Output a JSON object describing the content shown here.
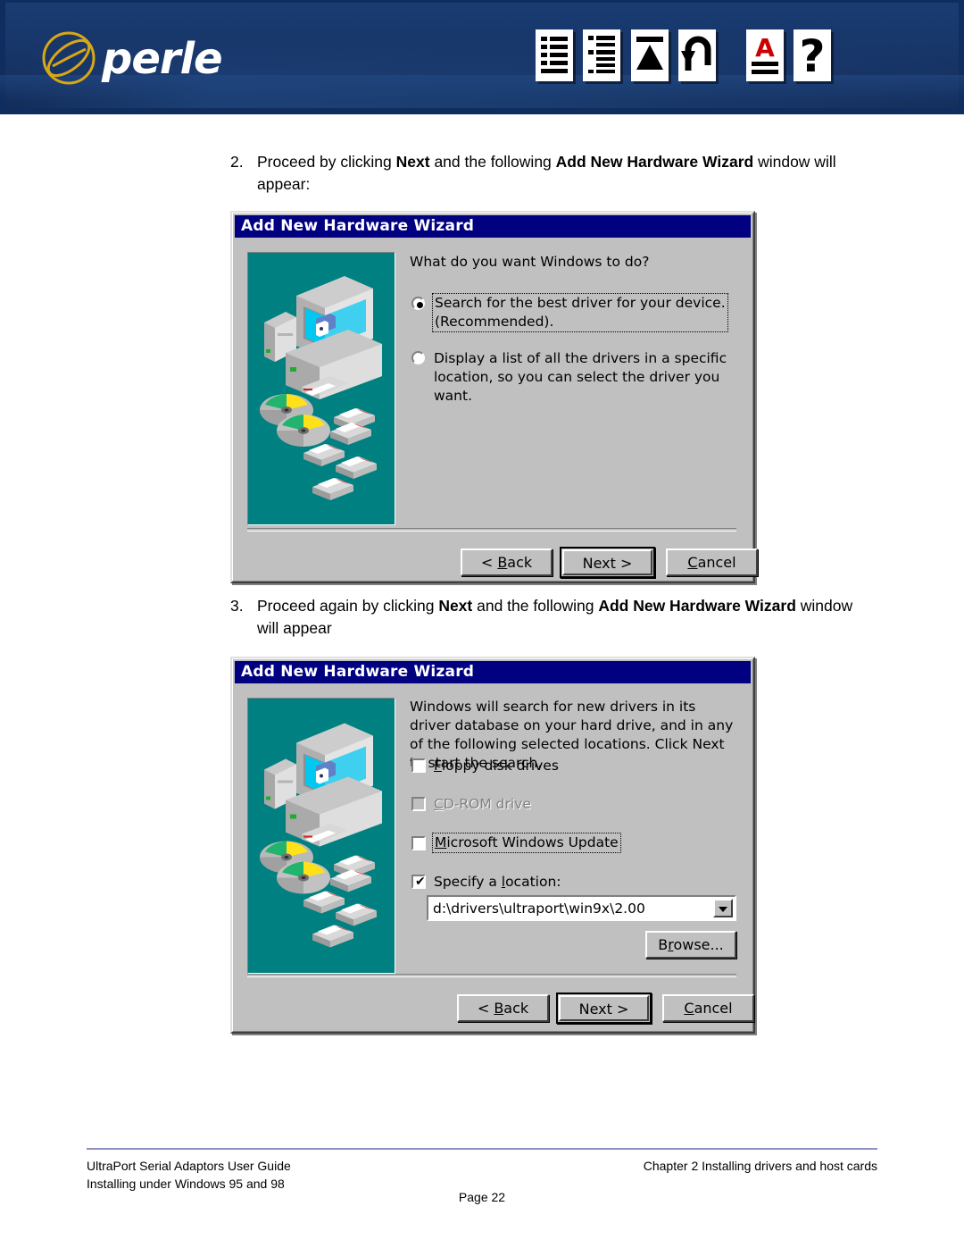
{
  "header": {
    "brand": "perle",
    "logo_icon": "perle-circle-logo",
    "nav_icons": [
      {
        "name": "table-of-contents-icon",
        "title": "Contents"
      },
      {
        "name": "index-list-icon",
        "title": "Index"
      },
      {
        "name": "go-to-top-icon",
        "title": "Top"
      },
      {
        "name": "go-back-arrow-icon",
        "title": "Back"
      },
      {
        "name": "find-text-icon",
        "title": "Find"
      },
      {
        "name": "help-question-icon",
        "title": "Help"
      }
    ],
    "banner_color": "#16306a",
    "brand_accent": "#d8a715"
  },
  "steps": [
    {
      "number": "2.",
      "parts": [
        {
          "t": "Proceed by clicking ",
          "b": false
        },
        {
          "t": "Next",
          "b": true
        },
        {
          "t": " and the following ",
          "b": false
        },
        {
          "t": "Add New Hardware Wizard",
          "b": true
        },
        {
          "t": " window will appear:",
          "b": false
        }
      ]
    },
    {
      "number": "3.",
      "parts": [
        {
          "t": "Proceed again by clicking ",
          "b": false
        },
        {
          "t": "Next",
          "b": true
        },
        {
          "t": " and the following ",
          "b": false
        },
        {
          "t": "Add New Hardware Wizard",
          "b": true
        },
        {
          "t": " window will appear",
          "b": false
        }
      ]
    }
  ],
  "dialog1": {
    "title": "Add New Hardware Wizard",
    "prompt": "What do you want Windows to do?",
    "options": [
      {
        "label": "Search for the best driver for your device.\n(Recommended).",
        "selected": true,
        "focused": true
      },
      {
        "label": "Display a list of all the drivers in a specific\nlocation, so you can select the driver you want.",
        "selected": false,
        "focused": false
      }
    ],
    "buttons": {
      "back": "< Back",
      "back_accel": "B",
      "next": "Next >",
      "cancel": "Cancel",
      "cancel_accel": "C",
      "default": "next"
    }
  },
  "dialog2": {
    "title": "Add New Hardware Wizard",
    "prompt": "Windows will search for new drivers in its driver database on your hard drive, and in any of the following selected locations. Click Next to start the search.",
    "checkboxes": [
      {
        "label": "Floppy disk drives",
        "accel": "F",
        "checked": false,
        "disabled": false,
        "focused": false
      },
      {
        "label": "CD-ROM drive",
        "accel": "C",
        "checked": false,
        "disabled": true,
        "focused": false
      },
      {
        "label": "Microsoft Windows Update",
        "accel": "M",
        "checked": false,
        "disabled": false,
        "focused": true
      },
      {
        "label": "Specify a location:",
        "accel": "l",
        "checked": true,
        "disabled": false,
        "focused": false
      }
    ],
    "location_value": "d:\\drivers\\ultraport\\win9x\\2.00",
    "browse_button": "Browse...",
    "browse_accel": "r",
    "buttons": {
      "back": "< Back",
      "back_accel": "B",
      "next": "Next >",
      "cancel": "Cancel",
      "cancel_accel": "C",
      "default": "next"
    }
  },
  "footer": {
    "line1": "UltraPort Serial Adaptors User Guide",
    "line2": "Installing under Windows 95 and 98",
    "right": "Chapter 2 Installing drivers and host cards",
    "page": "Page 22",
    "rule_color": "#8f8fc0"
  }
}
